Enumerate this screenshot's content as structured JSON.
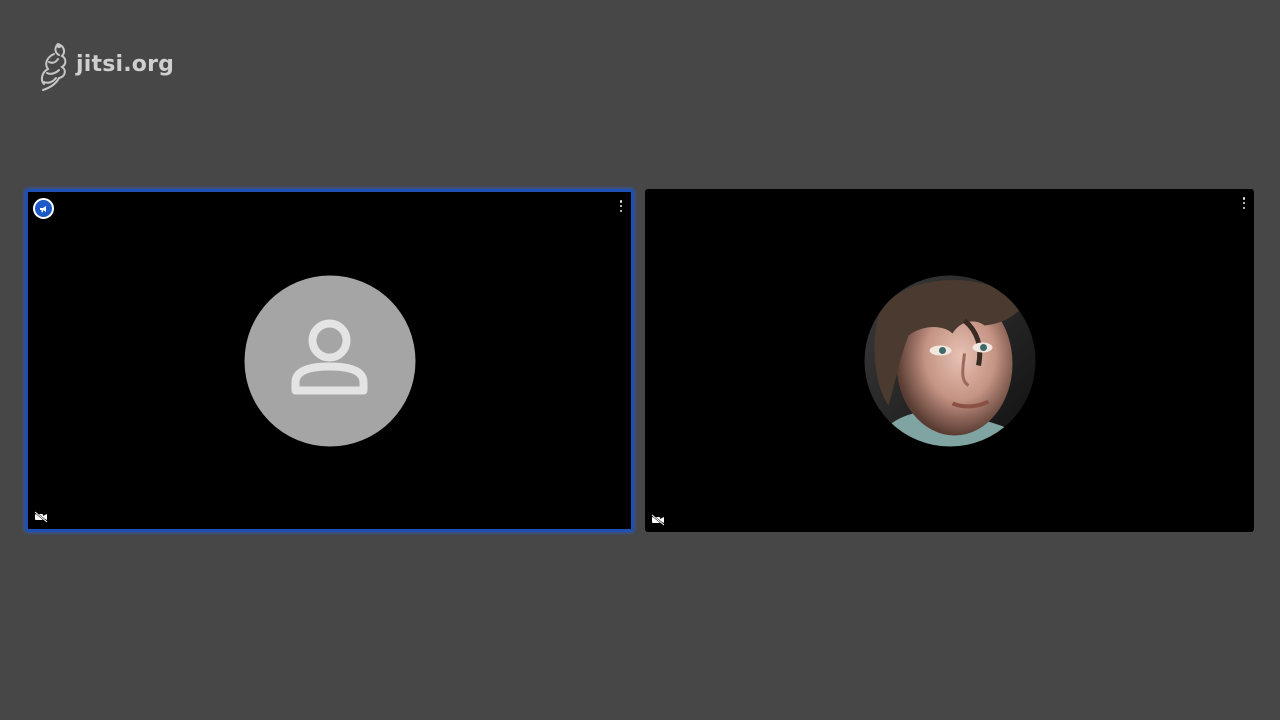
{
  "logo": {
    "text": "jitsi.org",
    "icon": "jitsi-logo-icon"
  },
  "tiles": [
    {
      "id": "local",
      "avatar": "default-user-icon",
      "dominant_speaker": true,
      "video_muted": true
    },
    {
      "id": "remote",
      "avatar": "user-photo",
      "dominant_speaker": false,
      "video_muted": true
    }
  ],
  "colors": {
    "background": "#474747",
    "tile_background": "#000000",
    "active_border": "#1e50b4",
    "badge": "#1c5ac7",
    "default_avatar": "#a5a5a5"
  }
}
